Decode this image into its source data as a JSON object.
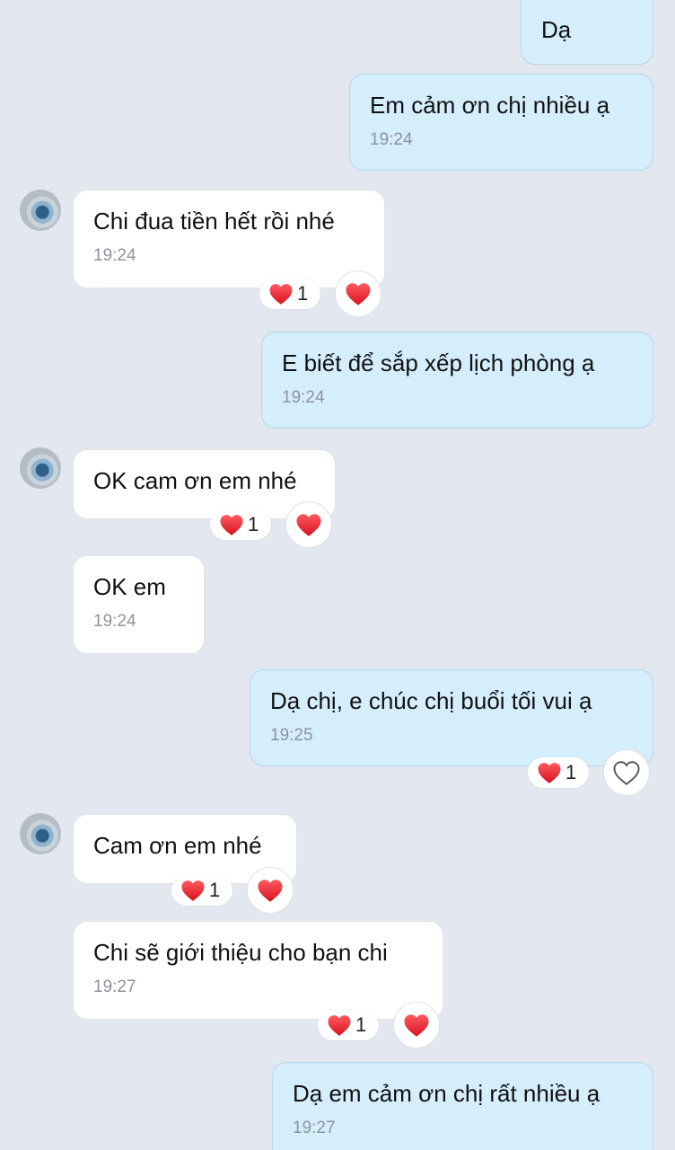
{
  "colors": {
    "background": "#e3e7ef",
    "incoming_bubble": "#ffffff",
    "outgoing_bubble": "#d5eefc",
    "heart": "#e8212c"
  },
  "messages": [
    {
      "direction": "outgoing",
      "text": "Dạ",
      "time": ""
    },
    {
      "direction": "outgoing",
      "text": "Em cảm ơn chị nhiều ạ",
      "time": "19:24"
    },
    {
      "direction": "incoming",
      "text": "Chi đua tiền hết rồi nhé",
      "time": "19:24",
      "reaction_count": "1",
      "reaction_icon": "heart-icon",
      "react_button_icon": "heart-filled-icon"
    },
    {
      "direction": "outgoing",
      "text": "E biết để sắp xếp lịch phòng ạ",
      "time": "19:24"
    },
    {
      "direction": "incoming",
      "text": "OK cam ơn em nhé",
      "time": "",
      "reaction_count": "1",
      "reaction_icon": "heart-icon",
      "react_button_icon": "heart-filled-icon"
    },
    {
      "direction": "incoming",
      "text": "OK em",
      "time": "19:24"
    },
    {
      "direction": "outgoing",
      "text": "Dạ chị, e chúc chị buổi tối vui ạ",
      "time": "19:25",
      "reaction_count": "1",
      "reaction_icon": "heart-icon",
      "react_button_icon": "heart-outline-icon"
    },
    {
      "direction": "incoming",
      "text": "Cam ơn em nhé",
      "time": "",
      "reaction_count": "1",
      "reaction_icon": "heart-icon",
      "react_button_icon": "heart-filled-icon"
    },
    {
      "direction": "incoming",
      "text": "Chi sẽ giới thiệu cho bạn chi",
      "time": "19:27",
      "reaction_count": "1",
      "reaction_icon": "heart-icon",
      "react_button_icon": "heart-filled-icon"
    },
    {
      "direction": "outgoing",
      "text": "Dạ em cảm ơn chị rất nhiều ạ",
      "time": "19:27"
    }
  ]
}
